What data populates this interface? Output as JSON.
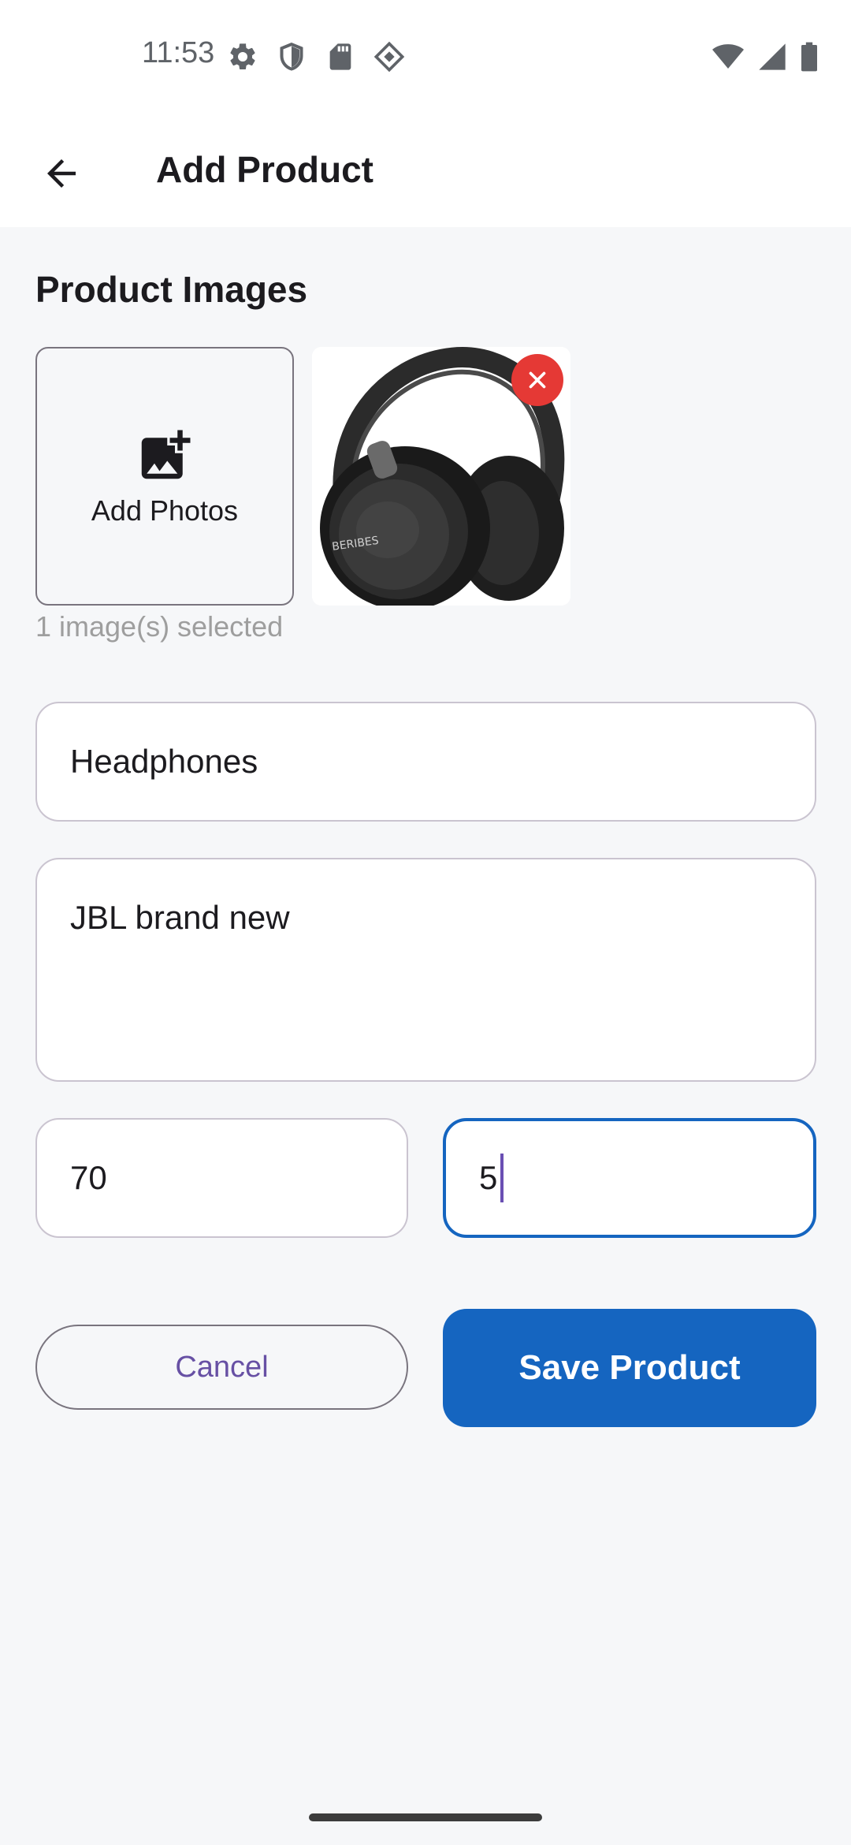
{
  "status_bar": {
    "time": "11:53",
    "icons": [
      "gear-icon",
      "shield-icon",
      "sd-card-icon",
      "device-icon",
      "wifi-icon",
      "signal-icon",
      "battery-icon"
    ]
  },
  "app_bar": {
    "title": "Add Product",
    "back_icon": "arrow-back-icon"
  },
  "images_section": {
    "title": "Product Images",
    "add_photos_label": "Add Photos",
    "selected_count_text": "1 image(s) selected",
    "thumbnail_brand_text": "BERIBES"
  },
  "form": {
    "name_value": "Headphones",
    "description_value": "JBL brand new",
    "price_value": "70",
    "quantity_value": "5"
  },
  "actions": {
    "cancel_label": "Cancel",
    "save_label": "Save Product"
  },
  "colors": {
    "primary": "#1565c0",
    "cancel_text": "#6750a4",
    "remove_badge": "#e53935",
    "background": "#f6f7f9"
  }
}
